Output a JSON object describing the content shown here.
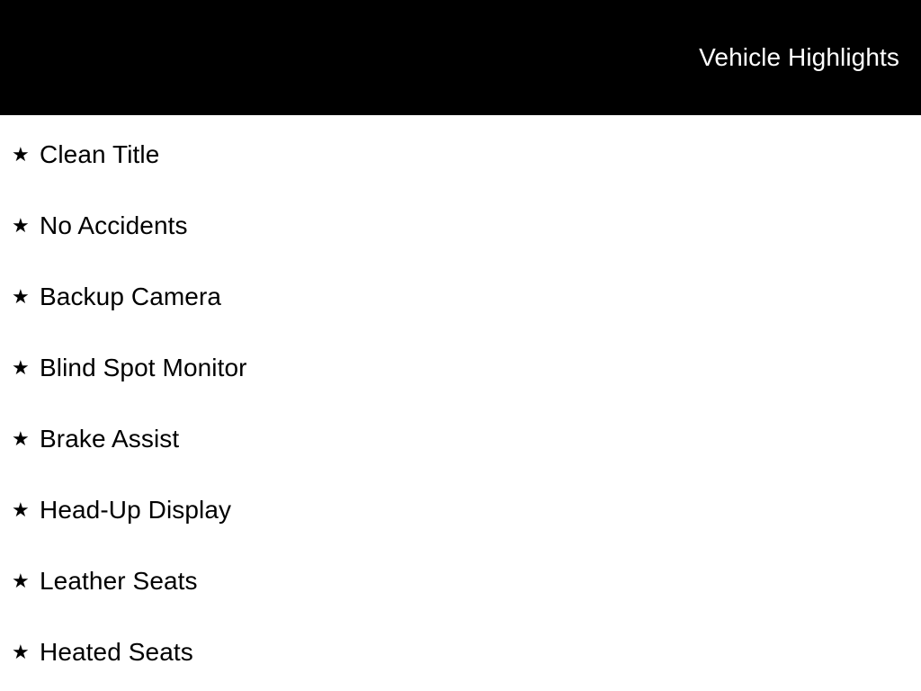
{
  "header": {
    "title": "Vehicle Highlights",
    "background_color": "#000000",
    "text_color": "#ffffff"
  },
  "body": {
    "background_color": "#ffffff",
    "text_color": "#000000"
  },
  "highlights": {
    "bullet_icon": "star-icon",
    "bullet_glyph": "★",
    "items": [
      {
        "label": "Clean Title"
      },
      {
        "label": "No Accidents"
      },
      {
        "label": "Backup Camera"
      },
      {
        "label": "Blind Spot Monitor"
      },
      {
        "label": "Brake Assist"
      },
      {
        "label": "Head-Up Display"
      },
      {
        "label": "Leather Seats"
      },
      {
        "label": "Heated Seats"
      }
    ]
  }
}
